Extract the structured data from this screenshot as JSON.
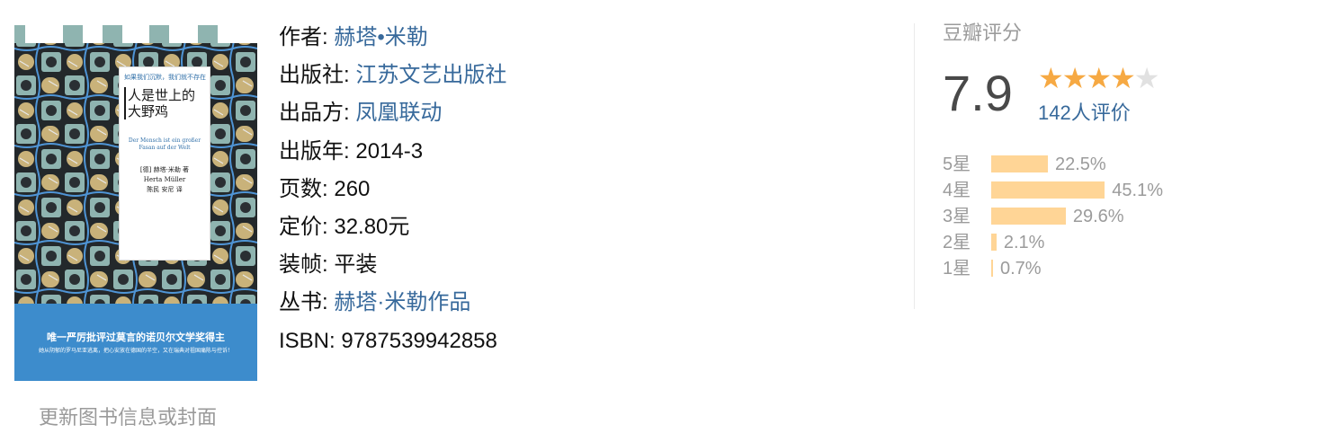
{
  "cover": {
    "tagline": "如果我们沉默，我们就不存在",
    "title_line1": "人是世上的",
    "title_line2": "大野鸡",
    "english_title": "Der Mensch ist ein großer Fasan auf der Welt",
    "author_cn": "[德] 赫塔·米勒 著",
    "author_en": "Herta Müller",
    "translator": "陈民 安尼 译",
    "slogan": "唯一严厉批评过莫言的诺贝尔文学奖得主",
    "subline": "她从阴郁的罗马尼亚逃离，把心安放在德国的半空，又在瑞典对祖国痛陈与控诉！"
  },
  "update_link": "更新图书信息或封面",
  "info": {
    "author": {
      "label": "作者:",
      "value": "赫塔•米勒"
    },
    "publisher": {
      "label": "出版社:",
      "value": "江苏文艺出版社"
    },
    "producer": {
      "label": "出品方:",
      "value": "凤凰联动"
    },
    "pub_year": {
      "label": "出版年:",
      "value": "2014-3"
    },
    "pages": {
      "label": "页数:",
      "value": "260"
    },
    "price": {
      "label": "定价:",
      "value": "32.80元"
    },
    "binding": {
      "label": "装帧:",
      "value": "平装"
    },
    "series": {
      "label": "丛书:",
      "value": "赫塔·米勒作品"
    },
    "isbn": {
      "label": "ISBN:",
      "value": "9787539942858"
    }
  },
  "rating": {
    "title": "豆瓣评分",
    "score": "7.9",
    "stars_filled": 4,
    "stars_total": 5,
    "count_text": "142人评价",
    "distribution": [
      {
        "label": "5星",
        "percent_text": "22.5%",
        "percent": 22.5
      },
      {
        "label": "4星",
        "percent_text": "45.1%",
        "percent": 45.1
      },
      {
        "label": "3星",
        "percent_text": "29.6%",
        "percent": 29.6
      },
      {
        "label": "2星",
        "percent_text": "2.1%",
        "percent": 2.1
      },
      {
        "label": "1星",
        "percent_text": "0.7%",
        "percent": 0.7
      }
    ],
    "colors": {
      "star_on": "#f6a943",
      "star_off": "#e1e1e1",
      "bar": "#ffd596",
      "link": "#37699b"
    }
  }
}
